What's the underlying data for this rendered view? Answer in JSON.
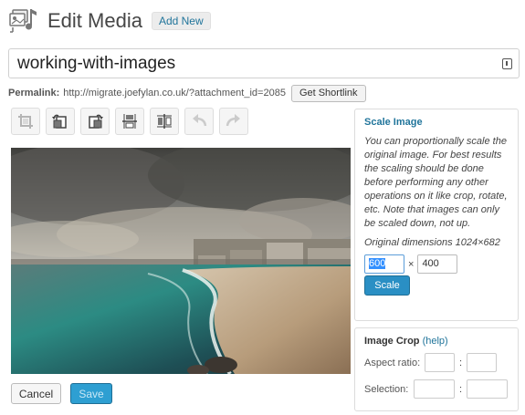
{
  "header": {
    "icon": "media-library-icon",
    "title": "Edit Media",
    "add_new_label": "Add New"
  },
  "title_field": {
    "value": "working-with-images"
  },
  "permalink": {
    "label": "Permalink:",
    "url": "http://migrate.joefylan.co.uk/?attachment_id=2085",
    "shortlink_button": "Get Shortlink"
  },
  "toolbar": {
    "tools": [
      {
        "name": "crop-icon",
        "enabled": false
      },
      {
        "name": "rotate-left-icon",
        "enabled": true
      },
      {
        "name": "rotate-right-icon",
        "enabled": true
      },
      {
        "name": "flip-vertical-icon",
        "enabled": true
      },
      {
        "name": "flip-horizontal-icon",
        "enabled": true
      },
      {
        "name": "undo-icon",
        "enabled": false
      },
      {
        "name": "redo-icon",
        "enabled": false
      }
    ]
  },
  "actions": {
    "cancel_label": "Cancel",
    "save_label": "Save"
  },
  "scale_panel": {
    "title": "Scale Image",
    "description": "You can proportionally scale the original image. For best results the scaling should be done before performing any other operations on it like crop, rotate, etc. Note that images can only be scaled down, not up.",
    "original_dimensions": "Original dimensions 1024×682",
    "width_value": "600",
    "times_symbol": "×",
    "height_value": "400",
    "scale_button": "Scale"
  },
  "crop_panel": {
    "title": "Image Crop",
    "help_link": "(help)",
    "aspect_label": "Aspect ratio:",
    "selection_label": "Selection:",
    "separator": ":"
  },
  "colors": {
    "accent": "#21759b",
    "primary_button": "#2a8fc4"
  }
}
